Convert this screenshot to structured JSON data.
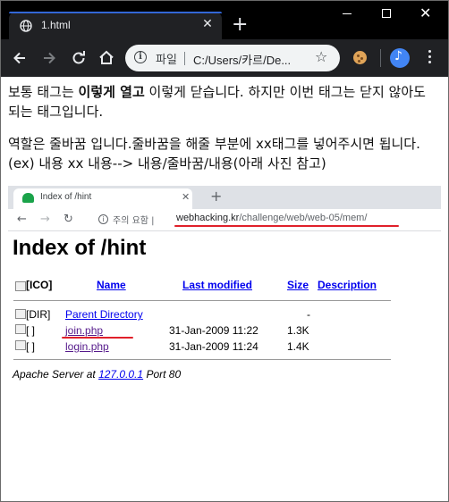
{
  "window": {
    "tab_title": "1.html",
    "new_tab": "+",
    "close_tab": "✕"
  },
  "toolbar": {
    "file_label": "파일",
    "url": "C:/Users/카르/De..."
  },
  "content": {
    "para1_pre": "보통 태그는 ",
    "para1_bold": "이렇게 열고",
    "para1_post": " 이렇게 닫습니다. 하지만 이번 태그는 닫지 않아도 되는 태그입니다.",
    "para2": "역할은 줄바꿈 입니다.줄바꿈을 해줄 부분에 xx태그를 넣어주시면 됩니다. (ex) 내용 xx 내용--> 내용/줄바꿈/내용(아래 사진 참고)"
  },
  "screenshot": {
    "tab_title": "Index of /hint",
    "tab_close": "✕",
    "new_tab": "+",
    "warning": "주의 요함",
    "url_domain": "webhacking.kr",
    "url_path": "/challenge/web/web-05/mem/",
    "heading": "Index of /hint",
    "columns": {
      "icon": "[ICO]",
      "name": "Name",
      "modified": "Last modified",
      "size": "Size",
      "description": "Description"
    },
    "rows": [
      {
        "icon": "[DIR]",
        "name": "Parent Directory",
        "modified": "",
        "size": "-"
      },
      {
        "icon": "[ ]",
        "name": "join.php",
        "modified": "31-Jan-2009 11:22",
        "size": "1.3K"
      },
      {
        "icon": "[ ]",
        "name": "login.php",
        "modified": "31-Jan-2009 11:24",
        "size": "1.4K"
      }
    ],
    "footer_pre": "Apache Server at ",
    "footer_link": "127.0.0.1",
    "footer_post": " Port 80"
  }
}
